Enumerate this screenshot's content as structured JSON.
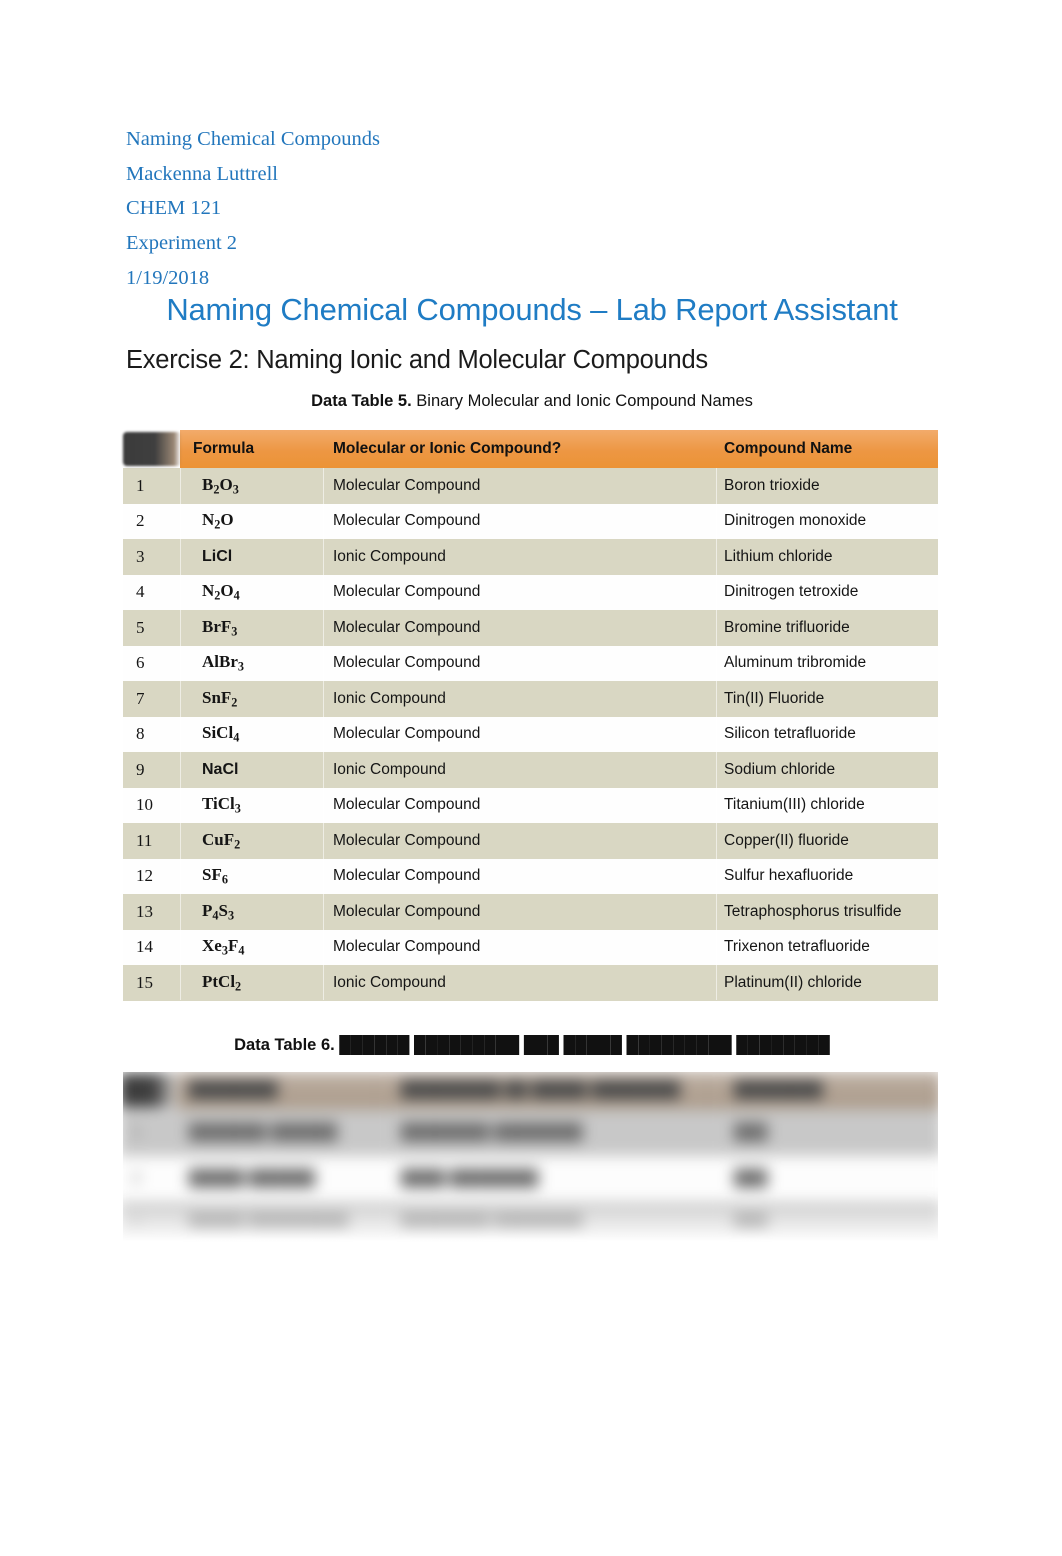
{
  "document": {
    "meta_lines": [
      "Naming Chemical Compounds",
      "Mackenna Luttrell",
      "CHEM 121",
      "Experiment 2",
      "1/19/2018"
    ],
    "title": "Naming Chemical Compounds – Lab Report Assistant",
    "exercise_heading": "Exercise 2: Naming Ionic and Molecular Compounds"
  },
  "colors": {
    "meta_text": "#2276BC",
    "title_text": "#1F7CC4",
    "table_header_orange": "#ED9743",
    "table_band": "#D9D7C3",
    "table_row": "#FEFEFE",
    "row_number_chip": "#3b3b3b",
    "body_text": "#151515",
    "blurred_band": "#C8C8C8"
  },
  "table5": {
    "caption_strong": "Data Table 5.",
    "caption_rest": " Binary Molecular and Ionic Compound Names",
    "headers": {
      "number": "",
      "formula": "Formula",
      "type": "Molecular or Ionic Compound?",
      "name": "Compound Name"
    },
    "rows": [
      {
        "n": "1",
        "formula_main": "B",
        "formula_parts": [
          [
            "B",
            ""
          ],
          [
            "",
            "2"
          ],
          [
            "O",
            ""
          ],
          [
            "",
            "3"
          ]
        ],
        "formula_html": "B<sub>2</sub>O<sub>3</sub>",
        "formula_text": "B2O3",
        "font": "serif",
        "type": "Molecular Compound",
        "name": "Boron trioxide"
      },
      {
        "n": "2",
        "formula_html": "N<sub>2</sub>O",
        "formula_text": "N2O",
        "font": "serif",
        "type": "Molecular Compound",
        "name": "Dinitrogen monoxide"
      },
      {
        "n": "3",
        "formula_html": "LiCl",
        "formula_text": "LiCl",
        "font": "sans",
        "type": "Ionic Compound",
        "name": "Lithium chloride"
      },
      {
        "n": "4",
        "formula_html": "N<sub>2</sub>O<sub>4</sub>",
        "formula_text": "N2O4",
        "font": "serif",
        "type": "Molecular Compound",
        "name": "Dinitrogen tetroxide"
      },
      {
        "n": "5",
        "formula_html": "BrF<sub>3</sub>",
        "formula_text": "BrF3",
        "font": "serif",
        "type": "Molecular Compound",
        "name": "Bromine trifluoride"
      },
      {
        "n": "6",
        "formula_html": "AlBr<sub>3</sub>",
        "formula_text": "AlBr3",
        "font": "serif",
        "type": "Molecular Compound",
        "name": "Aluminum tribromide"
      },
      {
        "n": "7",
        "formula_html": "SnF<sub>2</sub>",
        "formula_text": "SnF2",
        "font": "serif",
        "type": "Ionic Compound",
        "name": "Tin(II) Fluoride"
      },
      {
        "n": "8",
        "formula_html": "SiCl<sub>4</sub>",
        "formula_text": "SiCl4",
        "font": "serif",
        "type": "Molecular Compound",
        "name": "Silicon tetrafluoride"
      },
      {
        "n": "9",
        "formula_html": "NaCl",
        "formula_text": "NaCl",
        "font": "sans",
        "type": "Ionic Compound",
        "name": "Sodium chloride"
      },
      {
        "n": "10",
        "formula_html": "TiCl<sub>3</sub>",
        "formula_text": "TiCl3",
        "font": "serif",
        "type": "Molecular Compound",
        "name": "Titanium(III) chloride"
      },
      {
        "n": "11",
        "formula_html": "CuF<sub>2</sub>",
        "formula_text": "CuF2",
        "font": "serif",
        "type": "Molecular Compound",
        "name": "Copper(II) fluoride"
      },
      {
        "n": "12",
        "formula_html": "SF<sub>6</sub>",
        "formula_text": "SF6",
        "font": "serif",
        "type": "Molecular Compound",
        "name": "Sulfur hexafluoride"
      },
      {
        "n": "13",
        "formula_html": "P<sub>4</sub>S<sub>3</sub>",
        "formula_text": "P4S3",
        "font": "serif",
        "type": "Molecular Compound",
        "name": "Tetraphosphorus trisulfide"
      },
      {
        "n": "14",
        "formula_html": "Xe<sub>3</sub>F<sub>4</sub>",
        "formula_text": "Xe3F4",
        "font": "serif",
        "type": "Molecular Compound",
        "name": "Trixenon tetrafluoride"
      },
      {
        "n": "15",
        "formula_html": "PtCl<sub>2</sub>",
        "formula_text": "PtCl2",
        "font": "serif",
        "type": "Ionic Compound",
        "name": "Platinum(II) chloride"
      }
    ]
  },
  "table6": {
    "caption_strong": "Data Table 6.",
    "caption_rest": " ██████ █████████ ███ █████ █████████ ████████",
    "blurred": true,
    "headers": {
      "number": "",
      "formula": "████████",
      "type": "█████████ ██ █████ ████████",
      "name": "████████"
    },
    "rows": [
      {
        "n": "1",
        "formula": "███████ ██████",
        "type": "████████ ████████",
        "name": "███"
      },
      {
        "n": "2",
        "formula": "█████ ██████",
        "type": "████ ████████",
        "name": "███"
      },
      {
        "n": "3",
        "formula": "█████ █████████",
        "type": "████████ ████████",
        "name": "███"
      }
    ]
  }
}
